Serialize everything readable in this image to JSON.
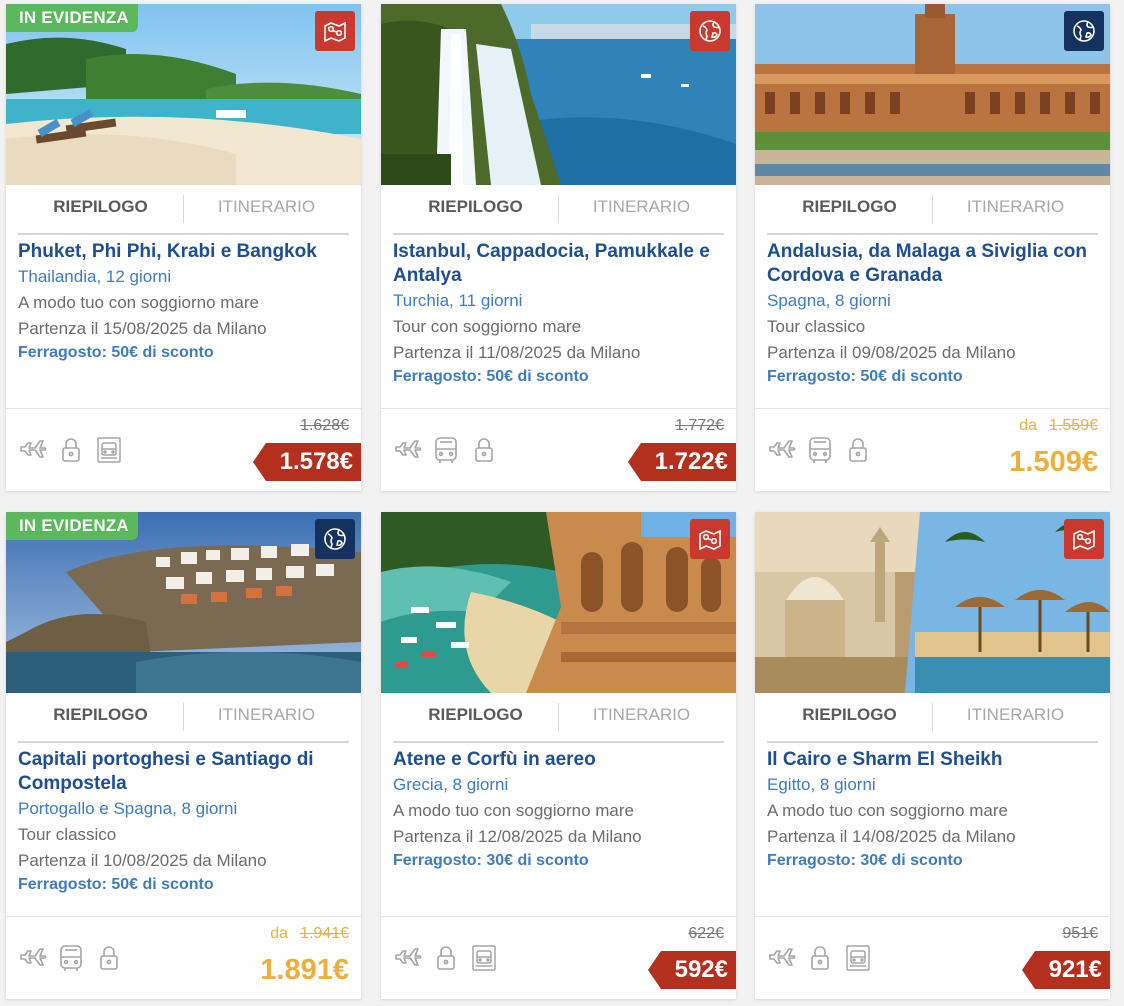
{
  "tab_riepilogo": "RIEPILOGO",
  "tab_itinerario": "ITINERARIO",
  "colors": {
    "title": "#1d4f91",
    "country": "#3e7cc1",
    "featured_badge": "#5cb85c",
    "type_red": "#c9392d",
    "type_blue": "#14325f",
    "price_red": "#b32f1e",
    "price_gold": "#efae3a"
  },
  "cards": [
    {
      "featured": "IN EVIDENZA",
      "type_icon": "map-pin-route-icon",
      "title": "Phuket, Phi Phi, Krabi e Bangkok",
      "country": "Thailandia, 12 giorni",
      "tour_type": "A modo tuo con soggiorno mare",
      "departure": "Partenza il 15/08/2025 da Milano",
      "promo": "Ferragosto: 50€ di sconto",
      "icons": [
        "plane-icon",
        "lock-icon",
        "hotel-bus-icon"
      ],
      "old_price": "1.628€",
      "price": "1.578€",
      "price_style": "red"
    },
    {
      "type_icon": "globe-icon",
      "title": "Istanbul, Cappadocia, Pamukkale e Antalya",
      "country": "Turchia, 11 giorni",
      "tour_type": "Tour con soggiorno mare",
      "departure": "Partenza il 11/08/2025 da Milano",
      "promo": "Ferragosto: 50€ di sconto",
      "icons": [
        "plane-icon",
        "bus-icon",
        "lock-icon"
      ],
      "old_price": "1.772€",
      "price": "1.722€",
      "price_style": "red"
    },
    {
      "type_icon": "globe-icon",
      "title": "Andalusia, da Malaga a Siviglia con Cordova e Granada",
      "country": "Spagna, 8 giorni",
      "tour_type": "Tour classico",
      "departure": "Partenza il 09/08/2025 da Milano",
      "promo": "Ferragosto: 50€ di sconto",
      "icons": [
        "plane-icon",
        "bus-icon",
        "lock-icon"
      ],
      "da": "da",
      "old_price": "1.559€",
      "price": "1.509€",
      "price_style": "gold"
    },
    {
      "featured": "IN EVIDENZA",
      "type_icon": "globe-icon",
      "title": "Capitali portoghesi e Santiago di Compostela",
      "country": "Portogallo e Spagna, 8 giorni",
      "tour_type": "Tour classico",
      "departure": "Partenza il 10/08/2025 da Milano",
      "promo": "Ferragosto: 50€ di sconto",
      "icons": [
        "plane-icon",
        "bus-icon",
        "lock-icon"
      ],
      "da": "da",
      "old_price": "1.941€",
      "price": "1.891€",
      "price_style": "gold"
    },
    {
      "type_icon": "map-pin-route-icon",
      "title": "Atene e Corfù in aereo",
      "country": "Grecia, 8 giorni",
      "tour_type": "A modo tuo con soggiorno mare",
      "departure": "Partenza il 12/08/2025 da Milano",
      "promo": "Ferragosto: 30€ di sconto",
      "icons": [
        "plane-icon",
        "lock-icon",
        "hotel-bus-icon"
      ],
      "old_price": "622€",
      "price": "592€",
      "price_style": "red"
    },
    {
      "type_icon": "map-pin-route-icon",
      "title": "Il Cairo e Sharm El Sheikh",
      "country": "Egitto, 8 giorni",
      "tour_type": "A modo tuo con soggiorno mare",
      "departure": "Partenza il 14/08/2025 da Milano",
      "promo": "Ferragosto: 30€ di sconto",
      "icons": [
        "plane-icon",
        "lock-icon",
        "hotel-bus-icon"
      ],
      "old_price": "951€",
      "price": "921€",
      "price_style": "red"
    }
  ]
}
